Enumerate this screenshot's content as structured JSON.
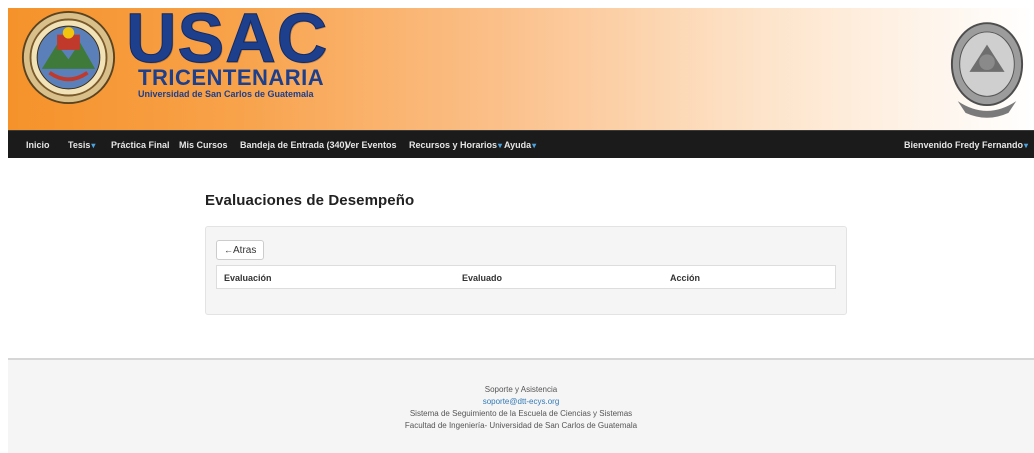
{
  "banner": {
    "title": "USAC",
    "subtitle": "TRICENTENARIA",
    "university": "Universidad de San Carlos de Guatemala"
  },
  "navbar": {
    "items": [
      {
        "label": "Inicio",
        "has_caret": false
      },
      {
        "label": "Tesis",
        "has_caret": true
      },
      {
        "label": "Práctica Final",
        "has_caret": false
      },
      {
        "label": "Mis Cursos",
        "has_caret": false
      },
      {
        "label": "Bandeja de Entrada (340)",
        "has_caret": false
      },
      {
        "label": "Ver Eventos",
        "has_caret": false
      },
      {
        "label": "Recursos y Horarios",
        "has_caret": true
      },
      {
        "label": "Ayuda",
        "has_caret": true
      }
    ],
    "user_menu": {
      "label": "Bienvenido Fredy Fernando",
      "has_caret": true
    },
    "caret_glyph": "▾"
  },
  "main": {
    "title": "Evaluaciones de Desempeño",
    "back_button": {
      "icon": "arrow-left-icon",
      "arrow": "←",
      "label": "Atras"
    },
    "table": {
      "columns": [
        "Evaluación",
        "Evaluado",
        "Acción"
      ],
      "rows": []
    }
  },
  "footer": {
    "lines": [
      "Soporte y Asistencia",
      "soporte@dtt-ecys.org",
      "Sistema de Seguimiento de la Escuela de Ciencias y Sistemas",
      "Facultad de Ingeniería- Universidad de San Carlos de Guatemala"
    ]
  },
  "colors": {
    "banner_orange": "#f5922a",
    "navbar_bg": "#1b1b1b",
    "brand_blue": "#1d3f8c",
    "link_blue": "#337ab7",
    "caret_blue": "#4aa3df"
  }
}
